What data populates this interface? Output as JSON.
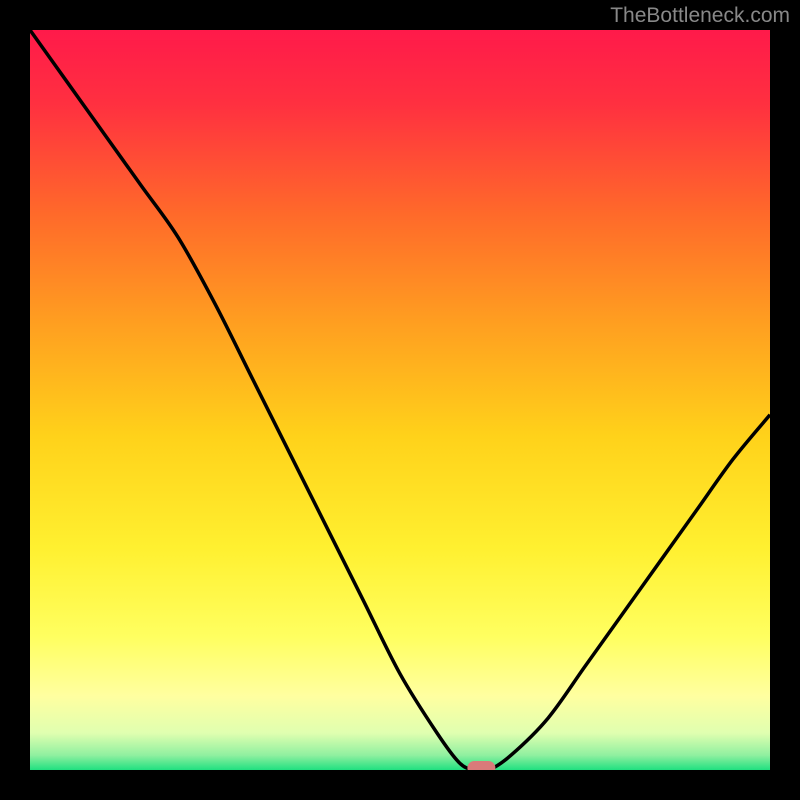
{
  "watermark": "TheBottleneck.com",
  "chart_data": {
    "type": "line",
    "title": "",
    "xlabel": "",
    "ylabel": "",
    "xlim": [
      0,
      100
    ],
    "ylim": [
      0,
      100
    ],
    "x": [
      0,
      5,
      10,
      15,
      20,
      25,
      30,
      35,
      40,
      45,
      50,
      55,
      58,
      60,
      62,
      65,
      70,
      75,
      80,
      85,
      90,
      95,
      100
    ],
    "values": [
      100,
      93,
      86,
      79,
      72,
      63,
      53,
      43,
      33,
      23,
      13,
      5,
      1,
      0,
      0,
      2,
      7,
      14,
      21,
      28,
      35,
      42,
      48
    ],
    "marker": {
      "x": 61,
      "y": 0,
      "color": "#d97a7a"
    },
    "background": "red-yellow-green-vertical-gradient"
  }
}
